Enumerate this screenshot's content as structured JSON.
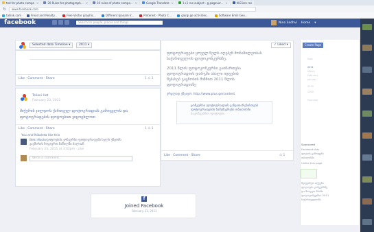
{
  "browser": {
    "tabs": [
      {
        "label": "ted for photo compe",
        "color": "#f0c04a"
      },
      {
        "label": "20 Rules for photograph...",
        "color": "#6b7fb2"
      },
      {
        "label": "10 rules of photo compo...",
        "color": "#6b7fb2"
      },
      {
        "label": "Google Translate",
        "color": "#4a89dc"
      },
      {
        "label": "1+1 rus subject - g pagover...",
        "color": "#2d9a2d"
      },
      {
        "label": "N.Elisro ros",
        "color": "#3b5998"
      }
    ],
    "url": "www.facebook.com",
    "bookmarks": [
      {
        "label": "tallink.com",
        "color": "#2aa7e0"
      },
      {
        "label": "Freud and Reality...",
        "color": "#3b5998"
      },
      {
        "label": "Free Vector graphic...",
        "color": "#e02020"
      },
      {
        "label": "Different Ipanam Ir...",
        "color": "#2d7fd1"
      },
      {
        "label": "Pinterest - Photo C...",
        "color": "#cc2233"
      },
      {
        "label": "giorgi.ge activities...",
        "color": "#2d8fd6"
      },
      {
        "label": "Software Emili Geo...",
        "color": "#e0a000"
      }
    ]
  },
  "facebook": {
    "logo": "facebook",
    "search_placeholder": "Search for people, places and things",
    "nav_right": [
      "Nino Sadhvi",
      "Home"
    ],
    "colors": {
      "brand": "#3b5998",
      "link": "#5b73a8",
      "button": "#5b7bc0"
    }
  },
  "header": {
    "selector_label": "Selected date",
    "selector_value": "Timeline ▾",
    "year_value": "2011 ▾",
    "liked_label": "✓ Liked ▾",
    "create_page": "Create Page"
  },
  "actions": {
    "left": "Like · Comment · Share",
    "right": "Like · Comment · Share",
    "counts_left_1": "1 ♺ 1",
    "counts_left_2": "1 ♺ 1",
    "counts_right": "♺ 1"
  },
  "posts": {
    "left_author": "Teliani Hot",
    "left_date": "February 23, 2011",
    "left_text_1": "მიჭერის ჯილდოს ქართველ ფოტოგრაფიას გამოცვლის და",
    "left_text_2": "ფოტოგრაფების ფოტოებით ვიცოცხლოთ",
    "left_likes": "You and Nikoleta like this",
    "comment_author": "Beki Abolo",
    "comment_text_1": "ფოტოების კონკურსი ფოტოგრაფებს ხელს უწყობს",
    "comment_text_2": "კავშირის ზოგიერთ ნაწილში ძალიან",
    "comment_date": "February 23, 2011 at 3:02pm · Like",
    "write_comment": "Write a comment...",
    "right_text_1": "ფოტოგრაფები ყოველ წელს იღებენ მონაწილეობას",
    "right_text_2": "საქართველოს ფოტოკონკურსზე.",
    "right_text_3": "2011 წლის ფოტოკონკურსი გაიმართება",
    "right_text_4": "ფოტოგრაფიის დარგში ახალი იდეების",
    "right_text_5": "შესახებ გაცნობის მიზნით 2011 წლის",
    "right_text_6": "ფოტოგრაფიაზე",
    "right_link": "ვრცლად ეწვიეთ: http://www.plus.ge/contest",
    "link_title_1": "კონკურსი ფოტოგრაფიის განვითარებისთვის",
    "link_title_2": "ფოტოგრაფების ნამუშევრები თბილისში",
    "link_title_3": "საკონკურსო ფოტოები"
  },
  "sidebar_years": [
    "Now",
    "2011",
    "March",
    "February",
    "January",
    "2010",
    "2009",
    "Founded"
  ],
  "sponsored": {
    "title": "Sponsored",
    "lines": [
      "Facebook Ads",
      "ფოტოს გამოფენა",
      "თბილისში"
    ],
    "like_label": "Unlike this page",
    "ad_lines": [
      "შეიყვანეთ თქვენი",
      "ფოტოები კონკურსზე",
      "და მიიღეთ პრიზი",
      "ფოტოკონკურსი 2011",
      "საქართველოში"
    ]
  },
  "joined": {
    "title": "Joined Facebook",
    "date": "February 23, 2011",
    "icon": "facebook-icon"
  }
}
